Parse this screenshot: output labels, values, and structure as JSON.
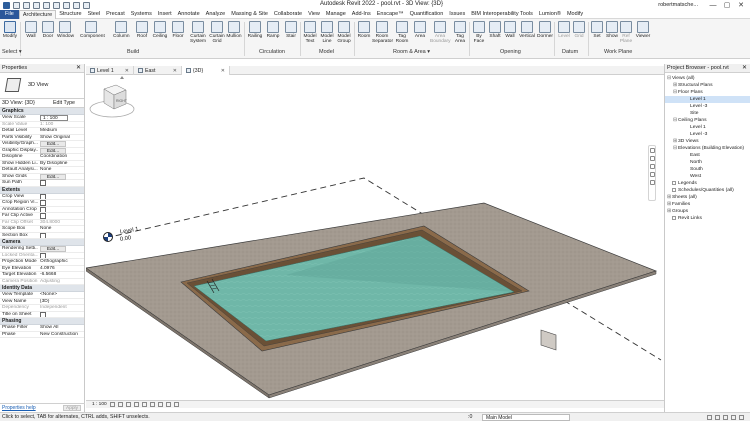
{
  "window": {
    "title": "Autodesk Revit 2022 - pool.rvt - 3D View: {3D}",
    "user": "robertmatsche...",
    "minimize": "—",
    "maximize": "▢",
    "close": "✕"
  },
  "ribbon_tabs": [
    "File",
    "Architecture",
    "Structure",
    "Steel",
    "Precast",
    "Systems",
    "Insert",
    "Annotate",
    "Analyze",
    "Massing & Site",
    "Collaborate",
    "View",
    "Manage",
    "Add-Ins",
    "Enscape™",
    "Quantification",
    "Issues",
    "BIM Interoperability Tools",
    "Lumion®",
    "Modify"
  ],
  "ribbon": {
    "buttons": [
      {
        "label": "Modify"
      },
      {
        "label": "Wall"
      },
      {
        "label": "Door"
      },
      {
        "label": "Window"
      },
      {
        "label": "Component"
      },
      {
        "label": "Column"
      },
      {
        "label": "Roof"
      },
      {
        "label": "Ceiling"
      },
      {
        "label": "Floor"
      },
      {
        "label": "Curtain System"
      },
      {
        "label": "Curtain Grid"
      },
      {
        "label": "Mullion"
      },
      {
        "label": "Railing"
      },
      {
        "label": "Ramp"
      },
      {
        "label": "Stair"
      },
      {
        "label": "Model Text"
      },
      {
        "label": "Model Line"
      },
      {
        "label": "Model Group"
      },
      {
        "label": "Room"
      },
      {
        "label": "Room Separator"
      },
      {
        "label": "Tag Room"
      },
      {
        "label": "Area"
      },
      {
        "label": "Area Boundary"
      },
      {
        "label": "Tag Area"
      },
      {
        "label": "By Face"
      },
      {
        "label": "Shaft"
      },
      {
        "label": "Wall"
      },
      {
        "label": "Vertical"
      },
      {
        "label": "Dormer"
      },
      {
        "label": "Level"
      },
      {
        "label": "Grid"
      },
      {
        "label": "Set"
      },
      {
        "label": "Show"
      },
      {
        "label": "Ref Plane"
      },
      {
        "label": "Viewer"
      }
    ],
    "panels": {
      "select": "Select ▾",
      "build": "Build",
      "circulation": "Circulation",
      "model": "Model",
      "room_area": "Room & Area ▾",
      "opening": "Opening",
      "datum": "Datum",
      "work_plane": "Work Plane"
    }
  },
  "properties": {
    "header": "Properties",
    "close": "✕",
    "type_name": "3D View",
    "instance": "3D View: {3D}",
    "edit_type": "Edit Type",
    "groups": {
      "graphics": "Graphics",
      "extents": "Extents",
      "camera": "Camera",
      "identity": "Identity Data",
      "phasing": "Phasing"
    },
    "graphics_rows": [
      {
        "k": "View Scale",
        "v": "1 : 100"
      },
      {
        "k": "Scale Value",
        "v": "1:     100"
      },
      {
        "k": "Detail Level",
        "v": "Medium"
      },
      {
        "k": "Parts Visibility",
        "v": "Show Original"
      },
      {
        "k": "Visibility/Graph...",
        "v": "Edit..."
      },
      {
        "k": "Graphic Display...",
        "v": "Edit..."
      },
      {
        "k": "Discipline",
        "v": "Coordination"
      },
      {
        "k": "Show Hidden Li...",
        "v": "By Discipline"
      },
      {
        "k": "Default Analysi...",
        "v": "None"
      },
      {
        "k": "Show Grids",
        "v": "Edit..."
      },
      {
        "k": "Sun Path",
        "v": ""
      }
    ],
    "extents_rows": [
      {
        "k": "Crop View",
        "v": ""
      },
      {
        "k": "Crop Region Vi...",
        "v": ""
      },
      {
        "k": "Annotation Crop",
        "v": ""
      },
      {
        "k": "Far Clip Active",
        "v": ""
      },
      {
        "k": "Far Clip Offset",
        "v": "304.8000"
      },
      {
        "k": "Scope Box",
        "v": "None"
      },
      {
        "k": "Section Box",
        "v": ""
      }
    ],
    "camera_rows": [
      {
        "k": "Rendering Setti...",
        "v": "Edit..."
      },
      {
        "k": "Locked Orienta...",
        "v": ""
      },
      {
        "k": "Projection Mode",
        "v": "Orthographic"
      },
      {
        "k": "Eye Elevation",
        "v": "4.0976"
      },
      {
        "k": "Target Elevation",
        "v": "-6.5668"
      },
      {
        "k": "Camera Position",
        "v": "Adjusting"
      }
    ],
    "identity_rows": [
      {
        "k": "View Template",
        "v": "<None>"
      },
      {
        "k": "View Name",
        "v": "{3D}"
      },
      {
        "k": "Dependency",
        "v": "Independent"
      },
      {
        "k": "Title on Sheet",
        "v": ""
      }
    ],
    "phasing_rows": [
      {
        "k": "Phase Filter",
        "v": "Show All"
      },
      {
        "k": "Phase",
        "v": "New Construction"
      }
    ],
    "help_link": "Properties help",
    "apply": "Apply"
  },
  "view_tabs": [
    {
      "label": "Level 1"
    },
    {
      "label": "East"
    },
    {
      "label": "{3D}"
    }
  ],
  "canvas": {
    "level_name": "Level 1",
    "level_elevation": "0.00",
    "viewcube_face": "RIGHT",
    "colors": {
      "slab": "#9d9389",
      "pool_rim": "#8a6a4a",
      "water": "#6fb7a8",
      "water_deep": "#5ea596",
      "edge": "#3c3c3c"
    }
  },
  "view_control": {
    "scale": "1 : 100"
  },
  "project_browser": {
    "header": "Project Browser - pool.rvt",
    "close": "✕",
    "items": [
      {
        "text": "Views (all)",
        "indent": 0,
        "toggle": "⊟"
      },
      {
        "text": "Structural Plans",
        "indent": 1,
        "toggle": "⊞"
      },
      {
        "text": "Floor Plans",
        "indent": 1,
        "toggle": "⊟"
      },
      {
        "text": "Level 1",
        "indent": 3,
        "toggle": "",
        "selected": true
      },
      {
        "text": "Level -3",
        "indent": 3,
        "toggle": ""
      },
      {
        "text": "Site",
        "indent": 3,
        "toggle": ""
      },
      {
        "text": "Ceiling Plans",
        "indent": 1,
        "toggle": "⊟"
      },
      {
        "text": "Level 1",
        "indent": 3,
        "toggle": ""
      },
      {
        "text": "Level -3",
        "indent": 3,
        "toggle": ""
      },
      {
        "text": "3D Views",
        "indent": 1,
        "toggle": "⊞"
      },
      {
        "text": "Elevations (Building Elevation)",
        "indent": 1,
        "toggle": "⊟"
      },
      {
        "text": "East",
        "indent": 3,
        "toggle": ""
      },
      {
        "text": "North",
        "indent": 3,
        "toggle": ""
      },
      {
        "text": "South",
        "indent": 3,
        "toggle": ""
      },
      {
        "text": "West",
        "indent": 3,
        "toggle": ""
      },
      {
        "text": "Legends",
        "indent": 0,
        "toggle": "",
        "icon": true
      },
      {
        "text": "Schedules/Quantities (all)",
        "indent": 0,
        "toggle": "",
        "icon": true
      },
      {
        "text": "Sheets (all)",
        "indent": 0,
        "toggle": "⊞"
      },
      {
        "text": "Families",
        "indent": 0,
        "toggle": "⊞"
      },
      {
        "text": "Groups",
        "indent": 0,
        "toggle": "⊞"
      },
      {
        "text": "Revit Links",
        "indent": 0,
        "toggle": "",
        "icon": true
      }
    ]
  },
  "status": {
    "hint": "Click to select, TAB for alternates, CTRL adds, SHIFT unselects.",
    "zero": ":0",
    "model": "Main Model"
  }
}
